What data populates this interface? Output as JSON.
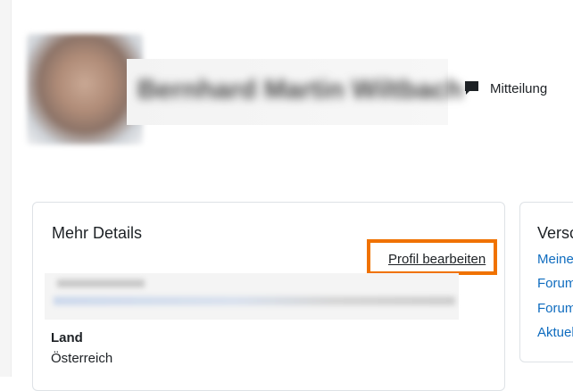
{
  "profile": {
    "user_name": "Bernhard Martin Wiltbach",
    "message_label": "Mitteilung"
  },
  "details": {
    "title": "Mehr Details",
    "edit_profile_link": "Profil bearbeiten",
    "country_label": "Land",
    "country_value": "Österreich"
  },
  "side": {
    "title": "Versc",
    "links": [
      "Meine",
      "Forum",
      "Forum",
      "Aktuel"
    ]
  },
  "colors": {
    "highlight": "#f07200",
    "link": "#0f6cbf"
  }
}
